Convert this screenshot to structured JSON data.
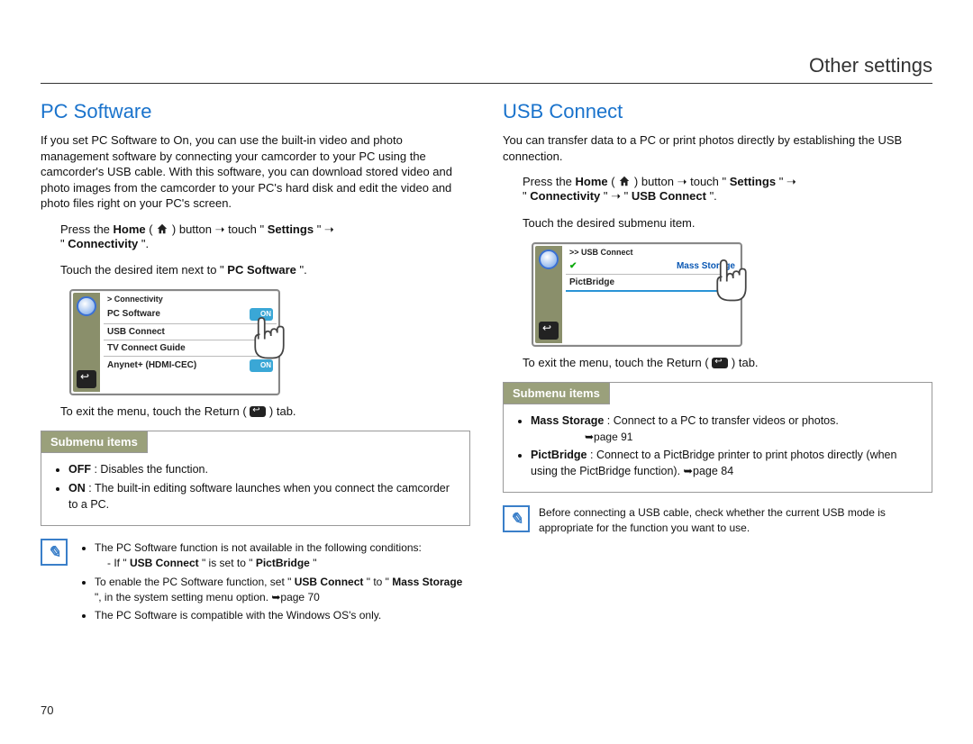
{
  "header": {
    "title": "Other settings"
  },
  "pagenum": "70",
  "left": {
    "title": "PC Software",
    "intro": "If you set PC Software to On, you can use the built-in video and photo management software by connecting your camcorder to your PC using the camcorder's USB cable. With this software, you can download stored video and photo images from the camcorder to your PC's hard disk and edit the video and photo files right on your PC's screen.",
    "nav_pre": "Press the ",
    "nav_home": "Home",
    "nav_mid": " button ➝ touch \"",
    "nav_settings": "Settings",
    "nav_end1": "\" ➝",
    "nav_line2_pre": "\"",
    "nav_conn": "Connectivity",
    "nav_line2_post": "\".",
    "step2_pre": "Touch the desired item next to \"",
    "step2_bold": "PC Software",
    "step2_post": "\".",
    "exit_pre": "To exit the menu, touch the Return (",
    "exit_post": ") tab.",
    "lcd": {
      "crumb": "> Connectivity",
      "rows": [
        {
          "label": "PC Software",
          "toggle": "ON"
        },
        {
          "label": "USB Connect",
          "toggle": ""
        },
        {
          "label": "TV Connect Guide",
          "toggle": ""
        },
        {
          "label": "Anynet+ (HDMI-CEC)",
          "toggle": "ON"
        }
      ]
    },
    "submenu_head": "Submenu items",
    "sub_off_b": "OFF",
    "sub_off_t": ": Disables the function.",
    "sub_on_b": "ON",
    "sub_on_t": ": The built-in editing software launches when you connect the camcorder to a PC.",
    "note1_line": "The PC Software function is not available in the following conditions:",
    "note1_sub_pre": "- If \"",
    "note1_sub_b1": "USB Connect",
    "note1_sub_mid": "\" is set to \"",
    "note1_sub_b2": "PictBridge",
    "note1_sub_post": "\"",
    "note2_pre": "To enable the PC Software function, set \"",
    "note2_b1": "USB Connect",
    "note2_mid": "\" to \"",
    "note2_b2": "Mass Storage",
    "note2_post": "\", in the system setting menu option. ➥page 70",
    "note3": "The PC Software is compatible with the Windows OS's only."
  },
  "right": {
    "title": "USB Connect",
    "intro": "You can transfer data to a PC or print photos directly by establishing the USB connection.",
    "nav_pre": "Press the ",
    "nav_home": "Home",
    "nav_mid": " button ➝ touch \"",
    "nav_settings": "Settings",
    "nav_end1": "\" ➝",
    "nav_line2_pre": "\"",
    "nav_conn": "Connectivity",
    "nav_line2_mid": "\" ➝ \"",
    "nav_usb": "USB Connect",
    "nav_line2_post": "\".",
    "step2": "Touch the desired submenu item.",
    "lcd": {
      "crumb": ">> USB Connect",
      "rows": [
        {
          "label": "Mass Storage",
          "selected": true
        },
        {
          "label": "PictBridge"
        }
      ]
    },
    "exit_pre": "To exit the menu, touch the Return (",
    "exit_post": ") tab.",
    "submenu_head": "Submenu items",
    "sub_mass_b": "Mass Storage",
    "sub_mass_t": " : Connect to a PC to transfer videos or photos.",
    "sub_mass_ref": "➥page 91",
    "sub_pict_b": "PictBridge",
    "sub_pict_t": " : Connect to a PictBridge printer to print photos directly (when using the PictBridge function). ➥page 84",
    "note": "Before connecting a USB cable, check whether the current USB mode is appropriate for the function you want to use."
  }
}
